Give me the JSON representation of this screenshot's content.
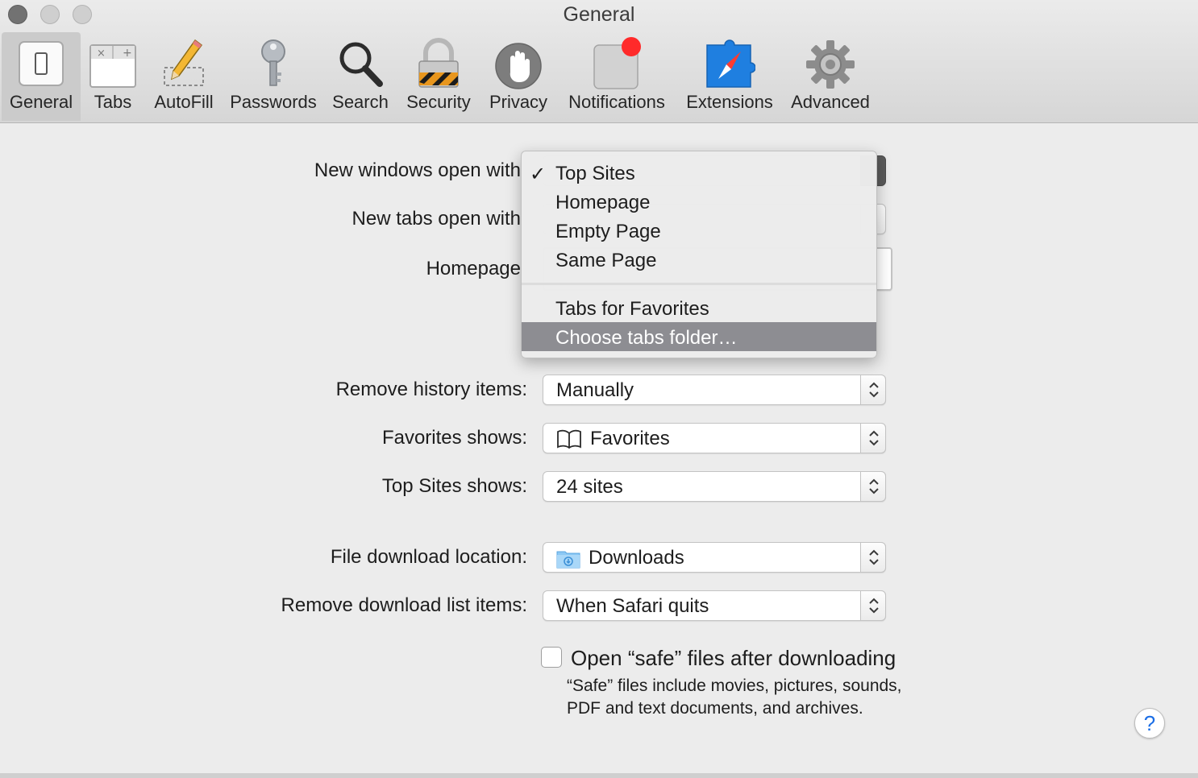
{
  "window": {
    "title": "General"
  },
  "toolbar": {
    "items": [
      {
        "label": "General",
        "icon": "switch-icon",
        "selected": true
      },
      {
        "label": "Tabs",
        "icon": "tabs-icon"
      },
      {
        "label": "AutoFill",
        "icon": "pencil-icon"
      },
      {
        "label": "Passwords",
        "icon": "key-icon"
      },
      {
        "label": "Search",
        "icon": "magnifier-icon"
      },
      {
        "label": "Security",
        "icon": "padlock-icon"
      },
      {
        "label": "Privacy",
        "icon": "hand-icon"
      },
      {
        "label": "Notifications",
        "icon": "notification-badge-icon"
      },
      {
        "label": "Extensions",
        "icon": "compass-puzzle-icon"
      },
      {
        "label": "Advanced",
        "icon": "gear-icon"
      }
    ]
  },
  "form": {
    "new_windows_label": "New windows open with",
    "new_tabs_label": "New tabs open with",
    "homepage_label": "Homepage",
    "remove_history_label": "Remove history items:",
    "remove_history_value": "Manually",
    "favorites_shows_label": "Favorites shows:",
    "favorites_shows_value": "Favorites",
    "top_sites_label": "Top Sites shows:",
    "top_sites_value": "24 sites",
    "download_location_label": "File download location:",
    "download_location_value": "Downloads",
    "remove_downloads_label": "Remove download list items:",
    "remove_downloads_value": "When Safari quits",
    "open_safe_label": "Open “safe” files after downloading",
    "open_safe_checked": false,
    "open_safe_note": "“Safe” files include movies, pictures, sounds, PDF and text documents, and archives.",
    "help_label": "?"
  },
  "menu": {
    "checkmark": "✓",
    "items": [
      {
        "label": "Top Sites",
        "checked": true
      },
      {
        "label": "Homepage"
      },
      {
        "label": "Empty Page"
      },
      {
        "label": "Same Page"
      },
      {
        "label": "Tabs for Favorites"
      },
      {
        "label": "Choose tabs folder…",
        "highlighted": true
      }
    ]
  },
  "colors": {
    "highlight": "#8d8d92",
    "notification_badge": "#ff2a2a",
    "extensions_blue": "#1f7fe0",
    "help_blue": "#1b6ee6"
  }
}
